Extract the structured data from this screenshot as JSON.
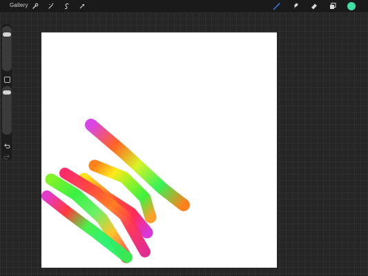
{
  "app": {
    "gallery_label": "Gallery"
  },
  "toolbar": {
    "left_icons": [
      "wrench-icon",
      "magic-wand-icon",
      "selection-icon",
      "transform-arrow-icon"
    ],
    "right_icons": [
      "brush-icon",
      "smudge-icon",
      "eraser-icon",
      "layers-icon",
      "color-swatch-icon"
    ],
    "active_tool": "brush",
    "current_color": "#3fe0a4",
    "brush_color": "#2f6fd6"
  },
  "sidebar": {
    "brush_size_level": 0.12,
    "opacity_level": 0.06,
    "controls": [
      "brush-size-slider",
      "modify-button",
      "opacity-slider",
      "undo-button",
      "redo-button"
    ]
  },
  "canvas": {
    "background": "#ffffff",
    "strokes": [
      {
        "name": "stroke-top",
        "colors": [
          "#d63ce6",
          "#ff5a1a",
          "#d8f21c",
          "#2af24d",
          "#ff7a10"
        ]
      },
      {
        "name": "stroke-second",
        "colors": [
          "#ff7a10",
          "#ffe810",
          "#8af21c",
          "#34f035",
          "#ff9a20"
        ]
      },
      {
        "name": "stroke-third",
        "colors": [
          "#ffe010",
          "#ff8a18",
          "#ff3a30",
          "#ff2050",
          "#d62bd8"
        ]
      },
      {
        "name": "stroke-fourth",
        "colors": [
          "#ff2060",
          "#ff4040",
          "#ff8020",
          "#ff3050",
          "#e0208a"
        ]
      },
      {
        "name": "stroke-fifth",
        "colors": [
          "#7af21c",
          "#2ff03a",
          "#62f060",
          "#ffc020",
          "#ff4050"
        ]
      },
      {
        "name": "stroke-bottom",
        "colors": [
          "#e030c8",
          "#ff3030",
          "#40f040",
          "#22f070",
          "#30f050"
        ]
      }
    ]
  }
}
